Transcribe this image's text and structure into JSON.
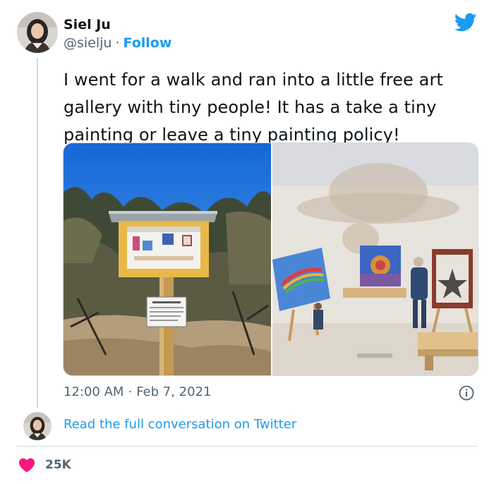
{
  "author": {
    "name": "Siel Ju",
    "handle": "@sielju",
    "follow_label": "Follow"
  },
  "tweet": {
    "text": "I went for a walk and ran into a little free art gallery with tiny people! It has a take a tiny painting or leave a tiny painting policy!",
    "time": "12:00 AM",
    "date": "Feb 7, 2021"
  },
  "media": {
    "photos": [
      {
        "subject": "little free art gallery box on a post with sign, desert shrubs, blue sky",
        "sign_text": "Little Free Art Gallery"
      },
      {
        "subject": "close-up inside the gallery: tiny paintings and miniature figurines"
      }
    ]
  },
  "footer": {
    "read_more": "Read the full conversation on Twitter",
    "likes": "25K"
  },
  "icons": {
    "logo": "twitter-bird-icon",
    "info": "info-icon",
    "like": "heart-icon"
  },
  "colors": {
    "accent": "#1d9bf0",
    "like": "#f91880",
    "secondary_text": "#536471",
    "border": "#cfd9de"
  }
}
